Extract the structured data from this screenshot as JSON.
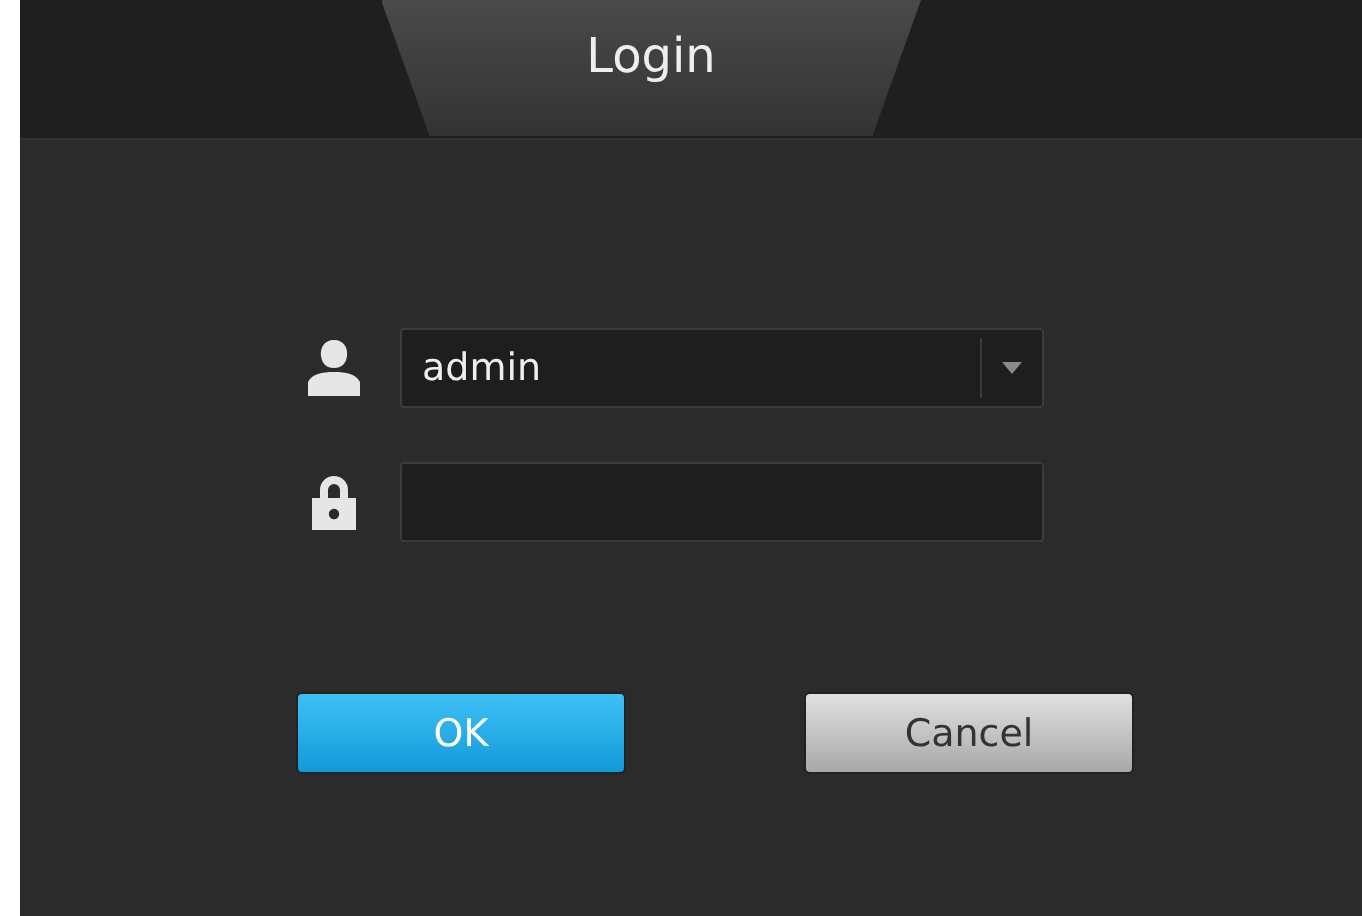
{
  "window": {
    "title": "Login"
  },
  "username": {
    "value": "admin"
  },
  "buttons": [
    {
      "label": "OK",
      "kind": "primary"
    },
    {
      "label": "Cancel",
      "kind": "secondary"
    }
  ]
}
